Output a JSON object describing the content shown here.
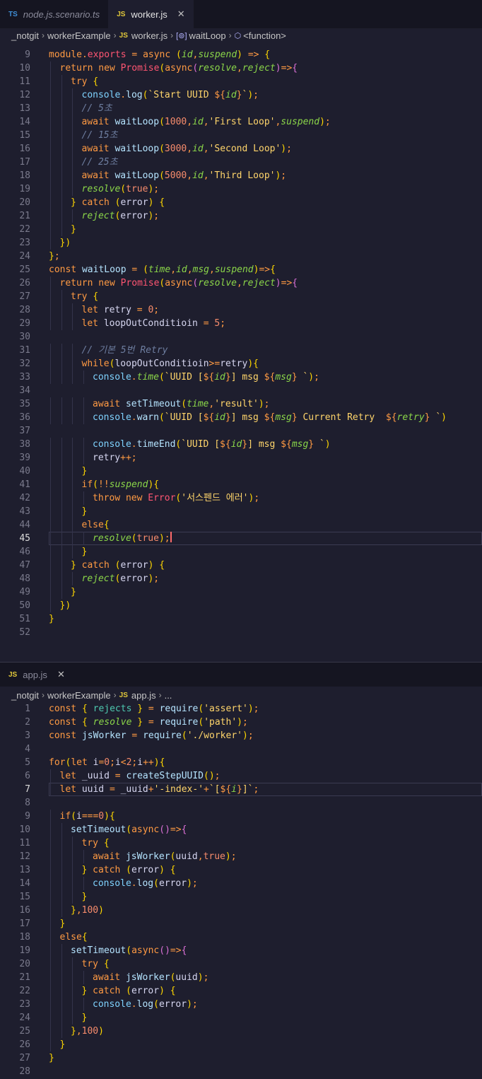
{
  "editor_top": {
    "tabs": [
      {
        "icon": "TS",
        "name": "node.js.scenario.ts",
        "active": false
      },
      {
        "icon": "JS",
        "name": "worker.js",
        "active": true,
        "close": "✕"
      }
    ],
    "breadcrumb": {
      "root": "_notgit",
      "folder": "workerExample",
      "file": "worker.js",
      "symbol1": "waitLoop",
      "symbol2": "<function>"
    },
    "current_line": 45,
    "lines": [
      {
        "n": 9,
        "text": "module.exports = async (id,suspend) => {"
      },
      {
        "n": 10,
        "text": "return new Promise(async(resolve,reject)=>{"
      },
      {
        "n": 11,
        "text": "try {"
      },
      {
        "n": 12,
        "text": "console.log(`Start UUID ${id}`);"
      },
      {
        "n": 13,
        "text": "// 5초"
      },
      {
        "n": 14,
        "text": "await waitLoop(1000,id,'First Loop',suspend);"
      },
      {
        "n": 15,
        "text": "// 15초"
      },
      {
        "n": 16,
        "text": "await waitLoop(3000,id,'Second Loop');"
      },
      {
        "n": 17,
        "text": "// 25초"
      },
      {
        "n": 18,
        "text": "await waitLoop(5000,id,'Third Loop');"
      },
      {
        "n": 19,
        "text": "resolve(true);"
      },
      {
        "n": 20,
        "text": "} catch (error) {"
      },
      {
        "n": 21,
        "text": "reject(error);"
      },
      {
        "n": 22,
        "text": "}"
      },
      {
        "n": 23,
        "text": "})"
      },
      {
        "n": 24,
        "text": "};"
      },
      {
        "n": 25,
        "text": "const waitLoop = (time,id,msg,suspend)=>{"
      },
      {
        "n": 26,
        "text": "return new Promise(async(resolve,reject)=>{"
      },
      {
        "n": 27,
        "text": "try {"
      },
      {
        "n": 28,
        "text": "let retry = 0;"
      },
      {
        "n": 29,
        "text": "let loopOutConditioin = 5;"
      },
      {
        "n": 30,
        "text": ""
      },
      {
        "n": 31,
        "text": "// 기본 5번 Retry"
      },
      {
        "n": 32,
        "text": "while(loopOutConditioin>=retry){"
      },
      {
        "n": 33,
        "text": "console.time(`UUID [${id}] msg ${msg} `);"
      },
      {
        "n": 34,
        "text": ""
      },
      {
        "n": 35,
        "text": "await setTimeout(time,'result');"
      },
      {
        "n": 36,
        "text": "console.warn(`UUID [${id}] msg ${msg} Current Retry  ${retry} `)"
      },
      {
        "n": 37,
        "text": ""
      },
      {
        "n": 38,
        "text": "console.timeEnd(`UUID [${id}] msg ${msg} `)"
      },
      {
        "n": 39,
        "text": "retry++;"
      },
      {
        "n": 40,
        "text": "}"
      },
      {
        "n": 41,
        "text": "if(!!suspend){"
      },
      {
        "n": 42,
        "text": "throw new Error('서스펜드 에러');"
      },
      {
        "n": 43,
        "text": "}"
      },
      {
        "n": 44,
        "text": "else{"
      },
      {
        "n": 45,
        "text": "resolve(true);"
      },
      {
        "n": 46,
        "text": "}"
      },
      {
        "n": 47,
        "text": "} catch (error) {"
      },
      {
        "n": 48,
        "text": "reject(error);"
      },
      {
        "n": 49,
        "text": "}"
      },
      {
        "n": 50,
        "text": "})"
      },
      {
        "n": 51,
        "text": "}"
      },
      {
        "n": 52,
        "text": ""
      }
    ]
  },
  "editor_bottom": {
    "tabs": [
      {
        "icon": "JS",
        "name": "app.js",
        "active": false,
        "close": "✕"
      }
    ],
    "breadcrumb": {
      "root": "_notgit",
      "folder": "workerExample",
      "file": "app.js",
      "rest": "..."
    },
    "current_line": 7,
    "lines": [
      {
        "n": 1,
        "text": "const { rejects } = require('assert');"
      },
      {
        "n": 2,
        "text": "const { resolve } = require('path');"
      },
      {
        "n": 3,
        "text": "const jsWorker = require('./worker');"
      },
      {
        "n": 4,
        "text": ""
      },
      {
        "n": 5,
        "text": "for(let i=0;i<2;i++){"
      },
      {
        "n": 6,
        "text": "let _uuid = createStepUUID();"
      },
      {
        "n": 7,
        "text": "let uuid = _uuid+'-index-'+`[${i}]`;"
      },
      {
        "n": 8,
        "text": ""
      },
      {
        "n": 9,
        "text": "if(i===0){"
      },
      {
        "n": 10,
        "text": "setTimeout(async()=>{"
      },
      {
        "n": 11,
        "text": "try {"
      },
      {
        "n": 12,
        "text": "await jsWorker(uuid,true);"
      },
      {
        "n": 13,
        "text": "} catch (error) {"
      },
      {
        "n": 14,
        "text": "console.log(error);"
      },
      {
        "n": 15,
        "text": "}"
      },
      {
        "n": 16,
        "text": "},100)"
      },
      {
        "n": 17,
        "text": "}"
      },
      {
        "n": 18,
        "text": "else{"
      },
      {
        "n": 19,
        "text": "setTimeout(async()=>{"
      },
      {
        "n": 20,
        "text": "try {"
      },
      {
        "n": 21,
        "text": "await jsWorker(uuid);"
      },
      {
        "n": 22,
        "text": "} catch (error) {"
      },
      {
        "n": 23,
        "text": "console.log(error);"
      },
      {
        "n": 24,
        "text": "}"
      },
      {
        "n": 25,
        "text": "},100)"
      },
      {
        "n": 26,
        "text": "}"
      },
      {
        "n": 27,
        "text": "}"
      },
      {
        "n": 28,
        "text": ""
      }
    ]
  }
}
